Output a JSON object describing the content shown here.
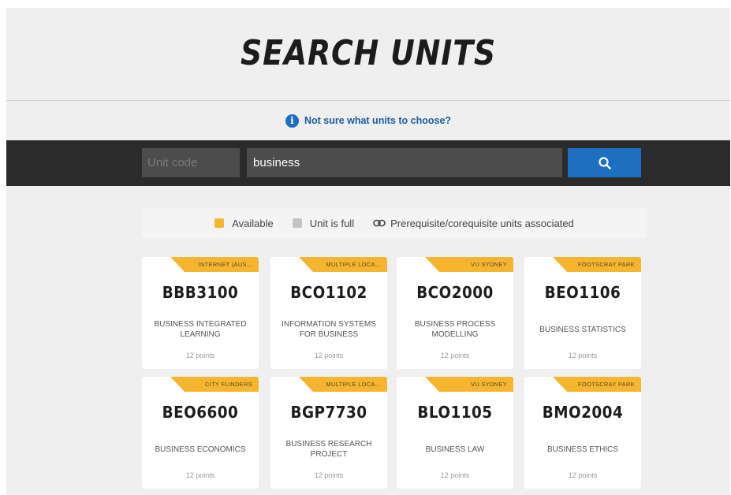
{
  "header": {
    "title": "SEARCH UNITS"
  },
  "help": {
    "link_text": "Not sure what units to choose?"
  },
  "search": {
    "unit_code_placeholder": "Unit code",
    "keyword_value": "business",
    "search_icon": "search-icon"
  },
  "legend": {
    "available_label": "Available",
    "full_label": "Unit is full",
    "prereq_label": "Prerequisite/corequisite units associated"
  },
  "colors": {
    "accent_yellow": "#f5b52f",
    "search_blue": "#1d6fc2",
    "bar_dark": "#2b2b2b",
    "unit_full_grey": "#c4c4c4"
  },
  "units": [
    {
      "location": "INTERNET (AUS...",
      "code": "BBB3100",
      "name": "BUSINESS INTEGRATED LEARNING",
      "points": "12 points"
    },
    {
      "location": "MULTIPLE LOCA...",
      "code": "BCO1102",
      "name": "INFORMATION SYSTEMS FOR BUSINESS",
      "points": "12 points"
    },
    {
      "location": "VU SYDNEY",
      "code": "BCO2000",
      "name": "BUSINESS PROCESS MODELLING",
      "points": "12 points"
    },
    {
      "location": "FOOTSCRAY PARK",
      "code": "BEO1106",
      "name": "BUSINESS STATISTICS",
      "points": "12 points"
    },
    {
      "location": "CITY FLINDERS",
      "code": "BEO6600",
      "name": "BUSINESS ECONOMICS",
      "points": "12 points"
    },
    {
      "location": "MULTIPLE LOCA...",
      "code": "BGP7730",
      "name": "BUSINESS RESEARCH PROJECT",
      "points": "12 points"
    },
    {
      "location": "VU SYDNEY",
      "code": "BLO1105",
      "name": "BUSINESS LAW",
      "points": "12 points"
    },
    {
      "location": "FOOTSCRAY PARK",
      "code": "BMO2004",
      "name": "BUSINESS ETHICS",
      "points": "12 points"
    }
  ]
}
